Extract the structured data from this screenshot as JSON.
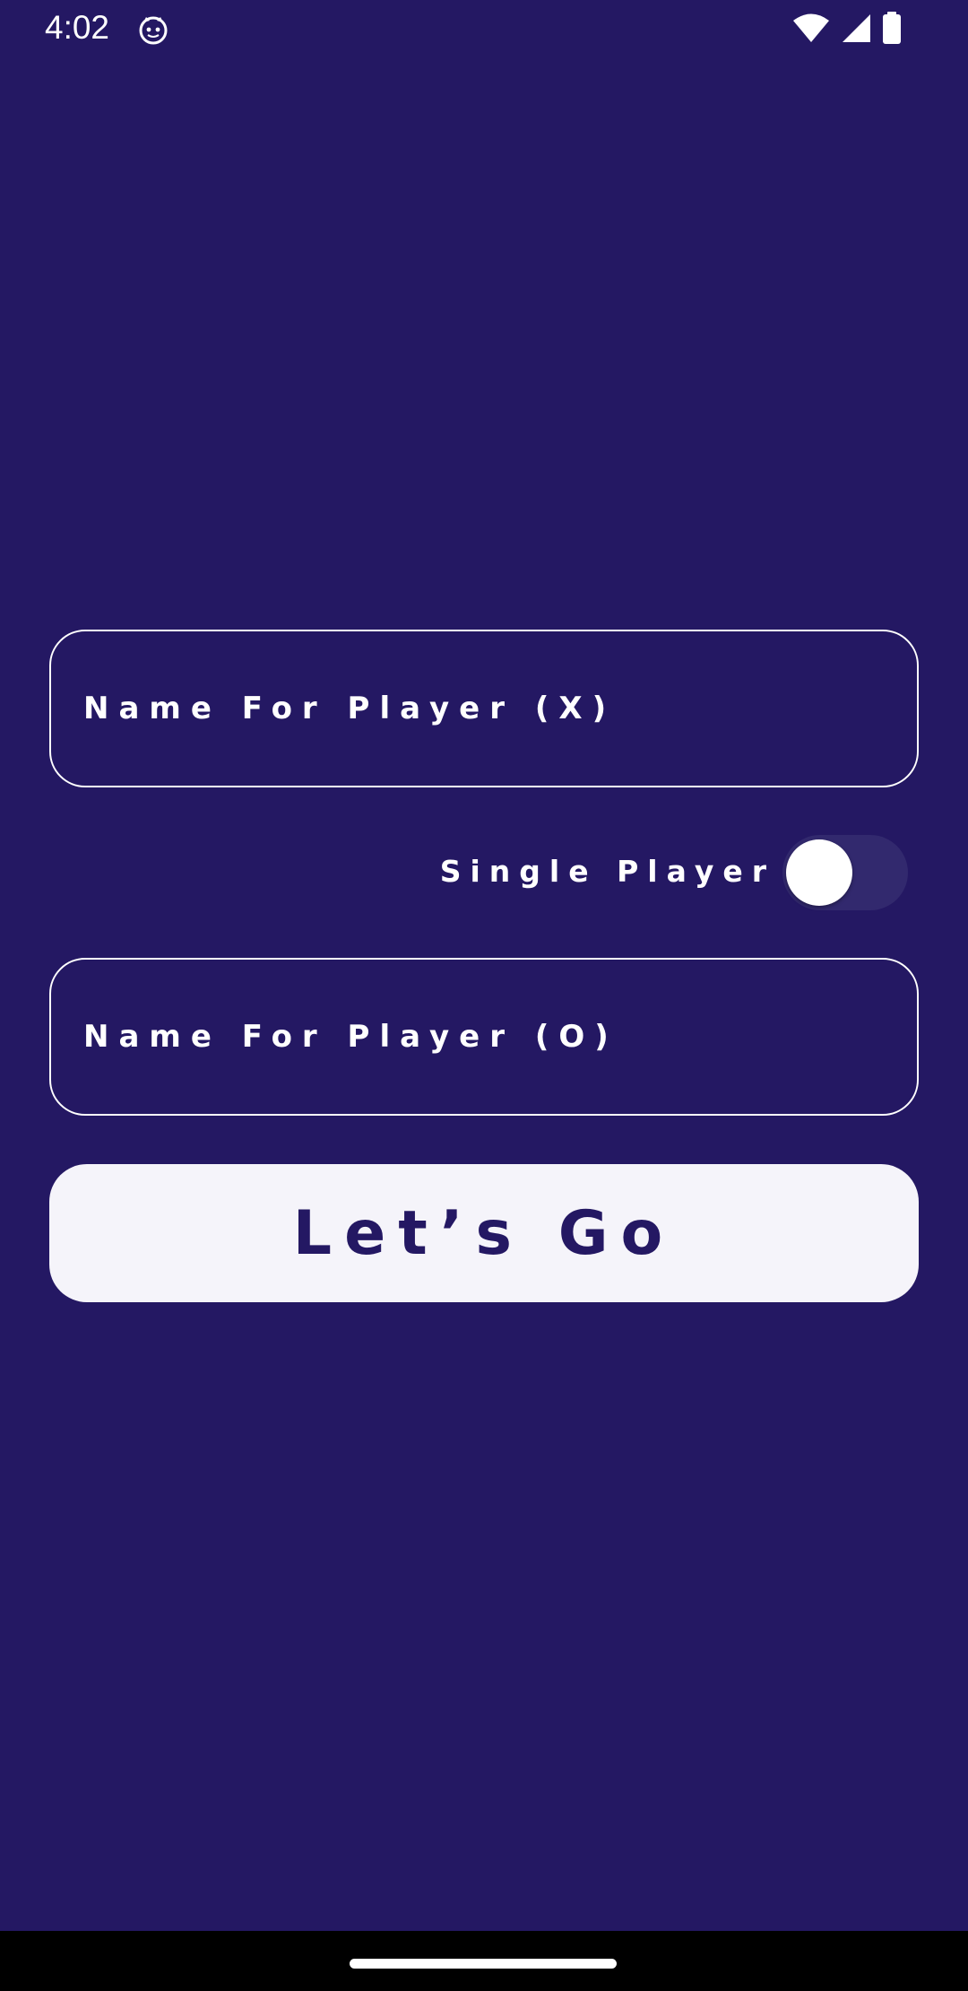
{
  "status_bar": {
    "time": "4:02",
    "app_icon": "cat-face-icon",
    "icons": [
      "wifi-icon",
      "signal-icon",
      "battery-icon"
    ]
  },
  "form": {
    "player_x_placeholder": "Name For Player (X)",
    "player_x_value": "",
    "single_player_label": "Single Player",
    "single_player_enabled": false,
    "player_o_placeholder": "Name For Player (O)",
    "player_o_value": "",
    "submit_label": "Let’s Go"
  },
  "colors": {
    "background": "#241863",
    "field_border": "#ffffff",
    "button_background": "#f5f4fa",
    "button_text": "#241863",
    "switch_track": "#32296e",
    "switch_thumb": "#ffffff",
    "nav_bar": "#000000"
  }
}
